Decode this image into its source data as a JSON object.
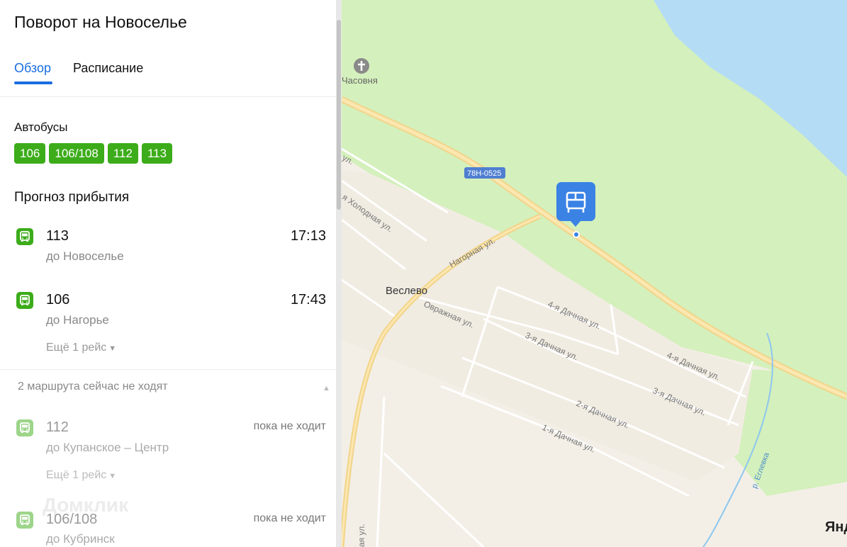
{
  "stop": {
    "title": "Поворот на Новоселье",
    "tabs": [
      {
        "label": "Обзор"
      },
      {
        "label": "Расписание"
      }
    ]
  },
  "buses": {
    "label": "Автобусы",
    "routes": [
      "106",
      "106/108",
      "112",
      "113"
    ]
  },
  "forecast": {
    "title": "Прогноз прибытия",
    "items": [
      {
        "number": "113",
        "destination": "до Новоселье",
        "time": "17:13"
      },
      {
        "number": "106",
        "destination": "до Нагорье",
        "time": "17:43",
        "more": "Ещё 1 рейс"
      }
    ]
  },
  "inactive": {
    "header": "2 маршрута сейчас не ходят",
    "items": [
      {
        "number": "112",
        "destination": "до Купанское – Центр",
        "status": "пока не ходит",
        "more": "Ещё 1 рейс"
      },
      {
        "number": "106/108",
        "destination": "до Кубринск",
        "status": "пока не ходит"
      }
    ]
  },
  "watermark": "Домклик",
  "map": {
    "labels": {
      "chapel": "Часовня",
      "road_code": "78Н-0525",
      "village": "Веслево",
      "river": "р. Еглевка",
      "logo": "Янд",
      "streets": {
        "ul1": "ул.",
        "holodnaya": "я Холодная ул.",
        "nagornaya": "Нагорная ул.",
        "ovrazhnaya": "Овражная ул.",
        "d4a": "4-я Дачная ул.",
        "d4b": "4-я Дачная ул.",
        "d3a": "3-я Дачная ул.",
        "d3b": "3-я Дачная ул.",
        "d2": "2-я Дачная ул.",
        "d1": "1-я Дачная ул.",
        "bottom": "ая ул."
      }
    },
    "colors": {
      "forest": "#d4f0bc",
      "residential": "#f3efe7",
      "water": "#b4dcf4",
      "road": "#f7d68a",
      "pin": "#3a82e4"
    }
  }
}
